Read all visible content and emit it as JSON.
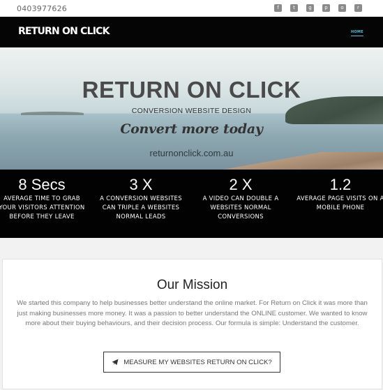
{
  "topbar": {
    "phone": "0403977626",
    "socials": [
      {
        "icon": "facebook-icon",
        "glyph": "f"
      },
      {
        "icon": "twitter-icon",
        "glyph": "t"
      },
      {
        "icon": "google-plus-icon",
        "glyph": "g"
      },
      {
        "icon": "pinterest-icon",
        "glyph": "p"
      },
      {
        "icon": "instagram-icon",
        "glyph": "o"
      },
      {
        "icon": "rss-icon",
        "glyph": "r"
      }
    ]
  },
  "navbar": {
    "brand": "RETURN ON CLICK",
    "home_label": "HOME",
    "accent": "#4ccbe0"
  },
  "hero": {
    "title": "RETURN ON CLICK",
    "subtitle": "CONVERSION WEBSITE DESIGN",
    "tagline": "Convert more today",
    "url": "returnonclick.com.au"
  },
  "stats": [
    {
      "number": "8 Secs",
      "text": "AVERAGE TIME TO GRAB YOUR VISITORS ATTENTION BEFORE THEY LEAVE"
    },
    {
      "number": "3 X",
      "text": "A CONVERSION WEBSITES CAN TRIPLE A WEBSITES NORMAL LEADS"
    },
    {
      "number": "2 X",
      "text": "A VIDEO CAN DOUBLE A WEBSITES NORMAL CONVERSIONS"
    },
    {
      "number": "1.2",
      "text": "AVERAGE PAGE VISITS ON A MOBILE PHONE"
    }
  ],
  "mission": {
    "title": "Our Mission",
    "body": "We started this company to help businesses better understand the online market. For Return on Click it was more than just making businesses more money. It was a passion to better understand the ONLINE customer. We wanted to know more about their buying behaviours, and their decision process. Our formula is simple: Understand the customer.",
    "cta_label": "MEASURE MY WEBSITES RETURN ON CLICK?"
  }
}
